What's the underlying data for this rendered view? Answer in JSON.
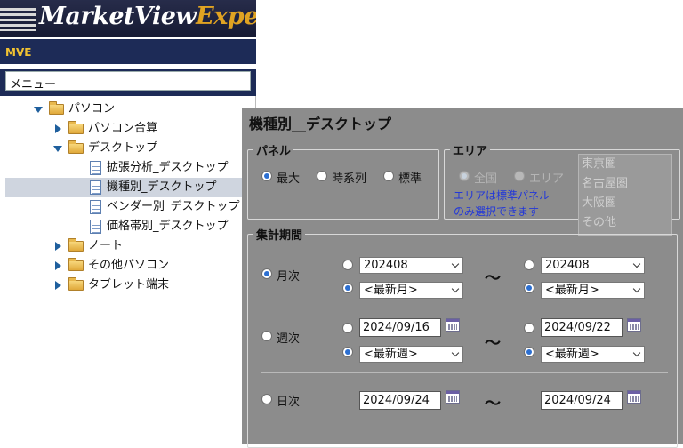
{
  "brand": {
    "logo_main": "MarketView",
    "logo_accent": "Exper",
    "subtitle": "MVE"
  },
  "menu": {
    "header": "メニュー",
    "tree": [
      {
        "label": "パソコン",
        "type": "folder",
        "expanded": true
      },
      {
        "label": "パソコン合算",
        "type": "folder",
        "expanded": false
      },
      {
        "label": "デスクトップ",
        "type": "folder",
        "expanded": true
      },
      {
        "label": "拡張分析_デスクトップ",
        "type": "doc"
      },
      {
        "label": "機種別_デスクトップ",
        "type": "doc",
        "selected": true
      },
      {
        "label": "ベンダー別_デスクトップ",
        "type": "doc"
      },
      {
        "label": "価格帯別_デスクトップ",
        "type": "doc"
      },
      {
        "label": "ノート",
        "type": "folder",
        "expanded": false
      },
      {
        "label": "その他パソコン",
        "type": "folder",
        "expanded": false
      },
      {
        "label": "タブレット端末",
        "type": "folder",
        "expanded": false
      }
    ]
  },
  "panel": {
    "title": "機種別__デスクトップ",
    "panel_group": {
      "legend": "パネル",
      "options": [
        "最大",
        "時系列",
        "標準"
      ],
      "selected": "最大"
    },
    "area_group": {
      "legend": "エリア",
      "options": [
        "全国",
        "エリア"
      ],
      "selected": "全国",
      "note_line1": "エリアは標準パネル",
      "note_line2": "のみ選択できます",
      "areas": [
        "東京圏",
        "名古屋圏",
        "大阪圏",
        "その他"
      ]
    },
    "period": {
      "legend": "集計期間",
      "tilde": "〜",
      "monthly": {
        "label": "月次",
        "from_month": "202408",
        "from_latest": "<最新月>",
        "to_month": "202408",
        "to_latest": "<最新月>"
      },
      "weekly": {
        "label": "週次",
        "from_date": "2024/09/16",
        "from_latest": "<最新週>",
        "to_date": "2024/09/22",
        "to_latest": "<最新週>"
      },
      "daily": {
        "label": "日次",
        "from_date": "2024/09/24",
        "to_date": "2024/09/24"
      }
    }
  }
}
